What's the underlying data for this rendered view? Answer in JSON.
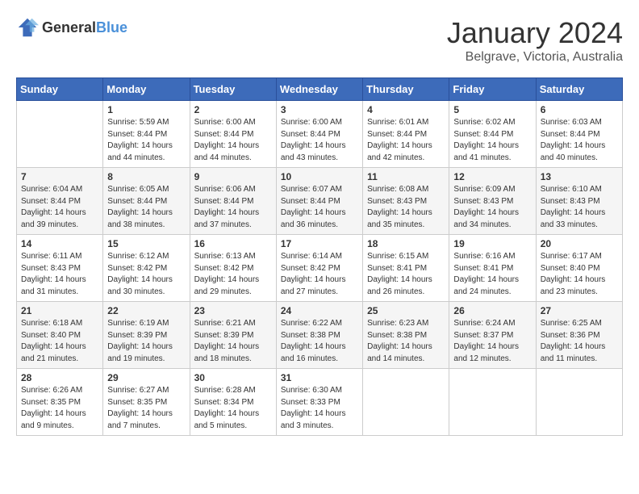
{
  "header": {
    "logo_general": "General",
    "logo_blue": "Blue",
    "month_year": "January 2024",
    "location": "Belgrave, Victoria, Australia"
  },
  "weekdays": [
    "Sunday",
    "Monday",
    "Tuesday",
    "Wednesday",
    "Thursday",
    "Friday",
    "Saturday"
  ],
  "weeks": [
    [
      {
        "day": "",
        "info": ""
      },
      {
        "day": "1",
        "info": "Sunrise: 5:59 AM\nSunset: 8:44 PM\nDaylight: 14 hours\nand 44 minutes."
      },
      {
        "day": "2",
        "info": "Sunrise: 6:00 AM\nSunset: 8:44 PM\nDaylight: 14 hours\nand 44 minutes."
      },
      {
        "day": "3",
        "info": "Sunrise: 6:00 AM\nSunset: 8:44 PM\nDaylight: 14 hours\nand 43 minutes."
      },
      {
        "day": "4",
        "info": "Sunrise: 6:01 AM\nSunset: 8:44 PM\nDaylight: 14 hours\nand 42 minutes."
      },
      {
        "day": "5",
        "info": "Sunrise: 6:02 AM\nSunset: 8:44 PM\nDaylight: 14 hours\nand 41 minutes."
      },
      {
        "day": "6",
        "info": "Sunrise: 6:03 AM\nSunset: 8:44 PM\nDaylight: 14 hours\nand 40 minutes."
      }
    ],
    [
      {
        "day": "7",
        "info": "Sunrise: 6:04 AM\nSunset: 8:44 PM\nDaylight: 14 hours\nand 39 minutes."
      },
      {
        "day": "8",
        "info": "Sunrise: 6:05 AM\nSunset: 8:44 PM\nDaylight: 14 hours\nand 38 minutes."
      },
      {
        "day": "9",
        "info": "Sunrise: 6:06 AM\nSunset: 8:44 PM\nDaylight: 14 hours\nand 37 minutes."
      },
      {
        "day": "10",
        "info": "Sunrise: 6:07 AM\nSunset: 8:44 PM\nDaylight: 14 hours\nand 36 minutes."
      },
      {
        "day": "11",
        "info": "Sunrise: 6:08 AM\nSunset: 8:43 PM\nDaylight: 14 hours\nand 35 minutes."
      },
      {
        "day": "12",
        "info": "Sunrise: 6:09 AM\nSunset: 8:43 PM\nDaylight: 14 hours\nand 34 minutes."
      },
      {
        "day": "13",
        "info": "Sunrise: 6:10 AM\nSunset: 8:43 PM\nDaylight: 14 hours\nand 33 minutes."
      }
    ],
    [
      {
        "day": "14",
        "info": "Sunrise: 6:11 AM\nSunset: 8:43 PM\nDaylight: 14 hours\nand 31 minutes."
      },
      {
        "day": "15",
        "info": "Sunrise: 6:12 AM\nSunset: 8:42 PM\nDaylight: 14 hours\nand 30 minutes."
      },
      {
        "day": "16",
        "info": "Sunrise: 6:13 AM\nSunset: 8:42 PM\nDaylight: 14 hours\nand 29 minutes."
      },
      {
        "day": "17",
        "info": "Sunrise: 6:14 AM\nSunset: 8:42 PM\nDaylight: 14 hours\nand 27 minutes."
      },
      {
        "day": "18",
        "info": "Sunrise: 6:15 AM\nSunset: 8:41 PM\nDaylight: 14 hours\nand 26 minutes."
      },
      {
        "day": "19",
        "info": "Sunrise: 6:16 AM\nSunset: 8:41 PM\nDaylight: 14 hours\nand 24 minutes."
      },
      {
        "day": "20",
        "info": "Sunrise: 6:17 AM\nSunset: 8:40 PM\nDaylight: 14 hours\nand 23 minutes."
      }
    ],
    [
      {
        "day": "21",
        "info": "Sunrise: 6:18 AM\nSunset: 8:40 PM\nDaylight: 14 hours\nand 21 minutes."
      },
      {
        "day": "22",
        "info": "Sunrise: 6:19 AM\nSunset: 8:39 PM\nDaylight: 14 hours\nand 19 minutes."
      },
      {
        "day": "23",
        "info": "Sunrise: 6:21 AM\nSunset: 8:39 PM\nDaylight: 14 hours\nand 18 minutes."
      },
      {
        "day": "24",
        "info": "Sunrise: 6:22 AM\nSunset: 8:38 PM\nDaylight: 14 hours\nand 16 minutes."
      },
      {
        "day": "25",
        "info": "Sunrise: 6:23 AM\nSunset: 8:38 PM\nDaylight: 14 hours\nand 14 minutes."
      },
      {
        "day": "26",
        "info": "Sunrise: 6:24 AM\nSunset: 8:37 PM\nDaylight: 14 hours\nand 12 minutes."
      },
      {
        "day": "27",
        "info": "Sunrise: 6:25 AM\nSunset: 8:36 PM\nDaylight: 14 hours\nand 11 minutes."
      }
    ],
    [
      {
        "day": "28",
        "info": "Sunrise: 6:26 AM\nSunset: 8:35 PM\nDaylight: 14 hours\nand 9 minutes."
      },
      {
        "day": "29",
        "info": "Sunrise: 6:27 AM\nSunset: 8:35 PM\nDaylight: 14 hours\nand 7 minutes."
      },
      {
        "day": "30",
        "info": "Sunrise: 6:28 AM\nSunset: 8:34 PM\nDaylight: 14 hours\nand 5 minutes."
      },
      {
        "day": "31",
        "info": "Sunrise: 6:30 AM\nSunset: 8:33 PM\nDaylight: 14 hours\nand 3 minutes."
      },
      {
        "day": "",
        "info": ""
      },
      {
        "day": "",
        "info": ""
      },
      {
        "day": "",
        "info": ""
      }
    ]
  ]
}
